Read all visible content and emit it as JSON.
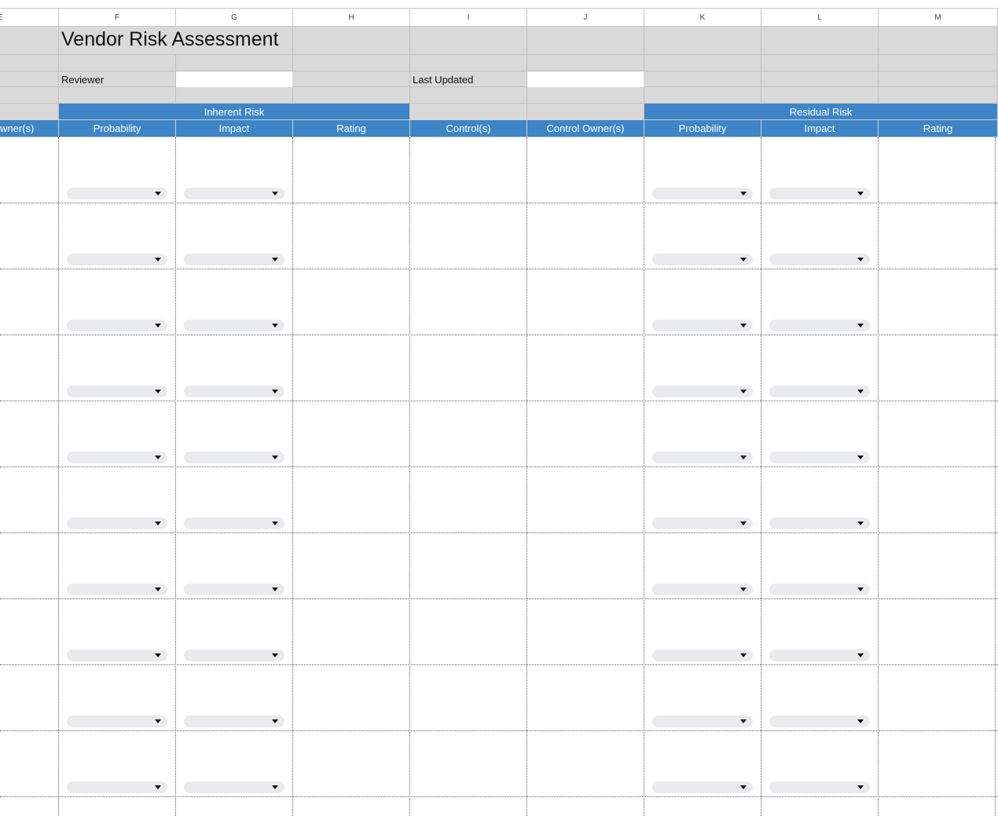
{
  "sheet": {
    "title": "Vendor Risk Assessment",
    "column_letters": [
      "E",
      "F",
      "G",
      "H",
      "I",
      "J",
      "K",
      "L",
      "M"
    ],
    "reviewer_label": "Reviewer",
    "reviewer_value": "",
    "last_updated_label": "Last Updated",
    "last_updated_value": "",
    "group_headers": {
      "inherent": "Inherent Risk",
      "residual": "Residual Risk"
    },
    "column_headers": {
      "e": "wner(s)",
      "f": "Probability",
      "g": "Impact",
      "h": "Rating",
      "i": "Control(s)",
      "j": "Control Owner(s)",
      "k": "Probability",
      "l": "Impact",
      "m": "Rating"
    },
    "dropdown_columns": [
      "F",
      "G",
      "K",
      "L"
    ],
    "row_count": 10,
    "colors": {
      "header_blue": "#3d85c6",
      "band_gray": "#d9d9d9",
      "dropdown_gray": "#e8eaed"
    }
  }
}
